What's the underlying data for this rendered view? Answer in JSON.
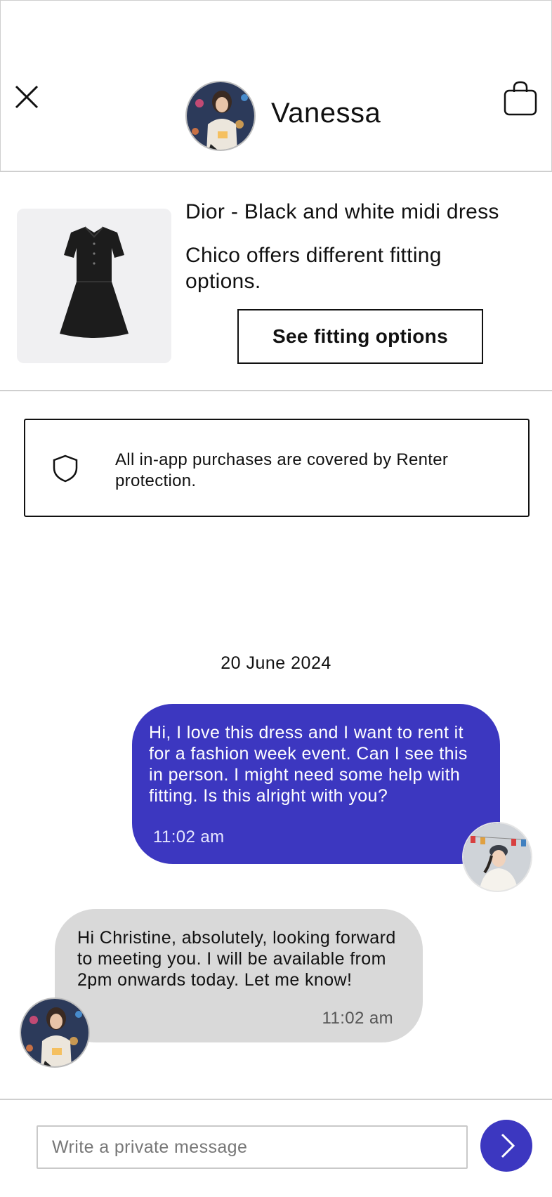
{
  "header": {
    "name": "Vanessa",
    "close_icon": "close-icon",
    "bag_icon": "shopping-bag-icon"
  },
  "product": {
    "title": "Dior - Black and white midi dress",
    "note": "Chico offers different fitting options.",
    "button_label": "See fitting options"
  },
  "protection": {
    "icon": "shield-icon",
    "text": "All in-app purchases are covered by Renter protection."
  },
  "chat": {
    "date": "20 June 2024",
    "messages": [
      {
        "direction": "outgoing",
        "text": "Hi, I love this dress and I want to rent it for a fashion week event.  Can I see this in person.  I might need some help with fitting.  Is this alright with you?",
        "time": "11:02 am"
      },
      {
        "direction": "incoming",
        "text": "Hi Christine, absolutely, looking forward to meeting you.  I will be available from 2pm onwards today.  Let me know!",
        "time": "11:02 am"
      }
    ]
  },
  "composer": {
    "placeholder": "Write a private message",
    "send_icon": "chevron-right-icon"
  },
  "colors": {
    "accent": "#3c37c0",
    "incoming_bubble": "#d9d9d9",
    "divider": "#cfcfcf"
  }
}
